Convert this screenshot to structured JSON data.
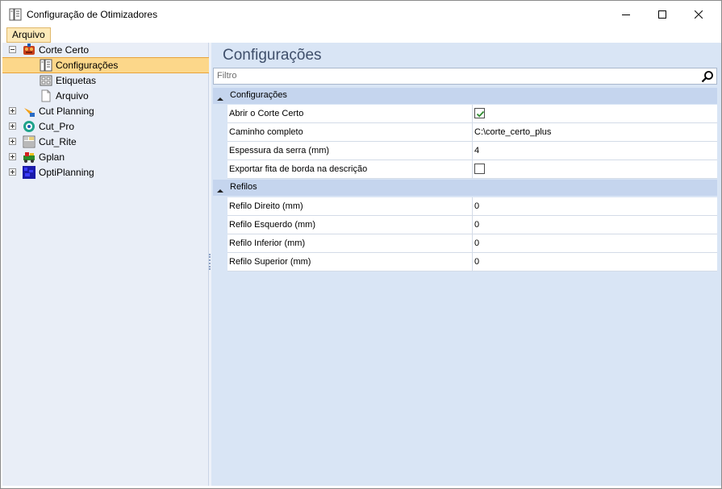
{
  "window": {
    "title": "Configuração de Otimizadores",
    "buttons": [
      "minimize",
      "maximize",
      "close"
    ]
  },
  "menu": {
    "items": [
      {
        "label": "Arquivo"
      }
    ]
  },
  "tree": {
    "items": [
      {
        "label": "Corte Certo",
        "icon": "corte-certo-icon",
        "expanded": true
      },
      {
        "label": "Configurações",
        "icon": "settings-list-icon",
        "selected": true
      },
      {
        "label": "Etiquetas",
        "icon": "labels-icon"
      },
      {
        "label": "Arquivo",
        "icon": "document-icon"
      },
      {
        "label": "Cut Planning",
        "icon": "cut-planning-icon",
        "expanded": false
      },
      {
        "label": "Cut_Pro",
        "icon": "cut-pro-icon",
        "expanded": false
      },
      {
        "label": "Cut_Rite",
        "icon": "cut-rite-icon",
        "expanded": false
      },
      {
        "label": "Gplan",
        "icon": "gplan-icon",
        "expanded": false
      },
      {
        "label": "OptiPlanning",
        "icon": "optiplanning-icon",
        "expanded": false
      }
    ]
  },
  "content": {
    "title": "Configurações",
    "filter_placeholder": "Filtro",
    "groups": [
      {
        "name": "Configurações",
        "properties": [
          {
            "name": "Abrir o Corte Certo",
            "value": "",
            "checkbox": true,
            "checked": true
          },
          {
            "name": "Caminho completo",
            "value": "C:\\corte_certo_plus"
          },
          {
            "name": "Espessura da serra (mm)",
            "value": "4"
          },
          {
            "name": "Exportar fita de borda na descrição",
            "value": "",
            "checkbox": true,
            "checked": false
          }
        ]
      },
      {
        "name": "Refilos",
        "properties": [
          {
            "name": "Refilo Direito (mm)",
            "value": "0"
          },
          {
            "name": "Refilo Esquerdo (mm)",
            "value": "0"
          },
          {
            "name": "Refilo Inferior (mm)",
            "value": "0"
          },
          {
            "name": "Refilo Superior (mm)",
            "value": "0"
          }
        ]
      }
    ]
  },
  "colors": {
    "selection": "#fcd78a",
    "selection_border": "#e8a33b",
    "panel_bg": "#d9e5f5",
    "group_header_bg": "#c5d5ee",
    "checkmark": "#2e8b2e"
  }
}
